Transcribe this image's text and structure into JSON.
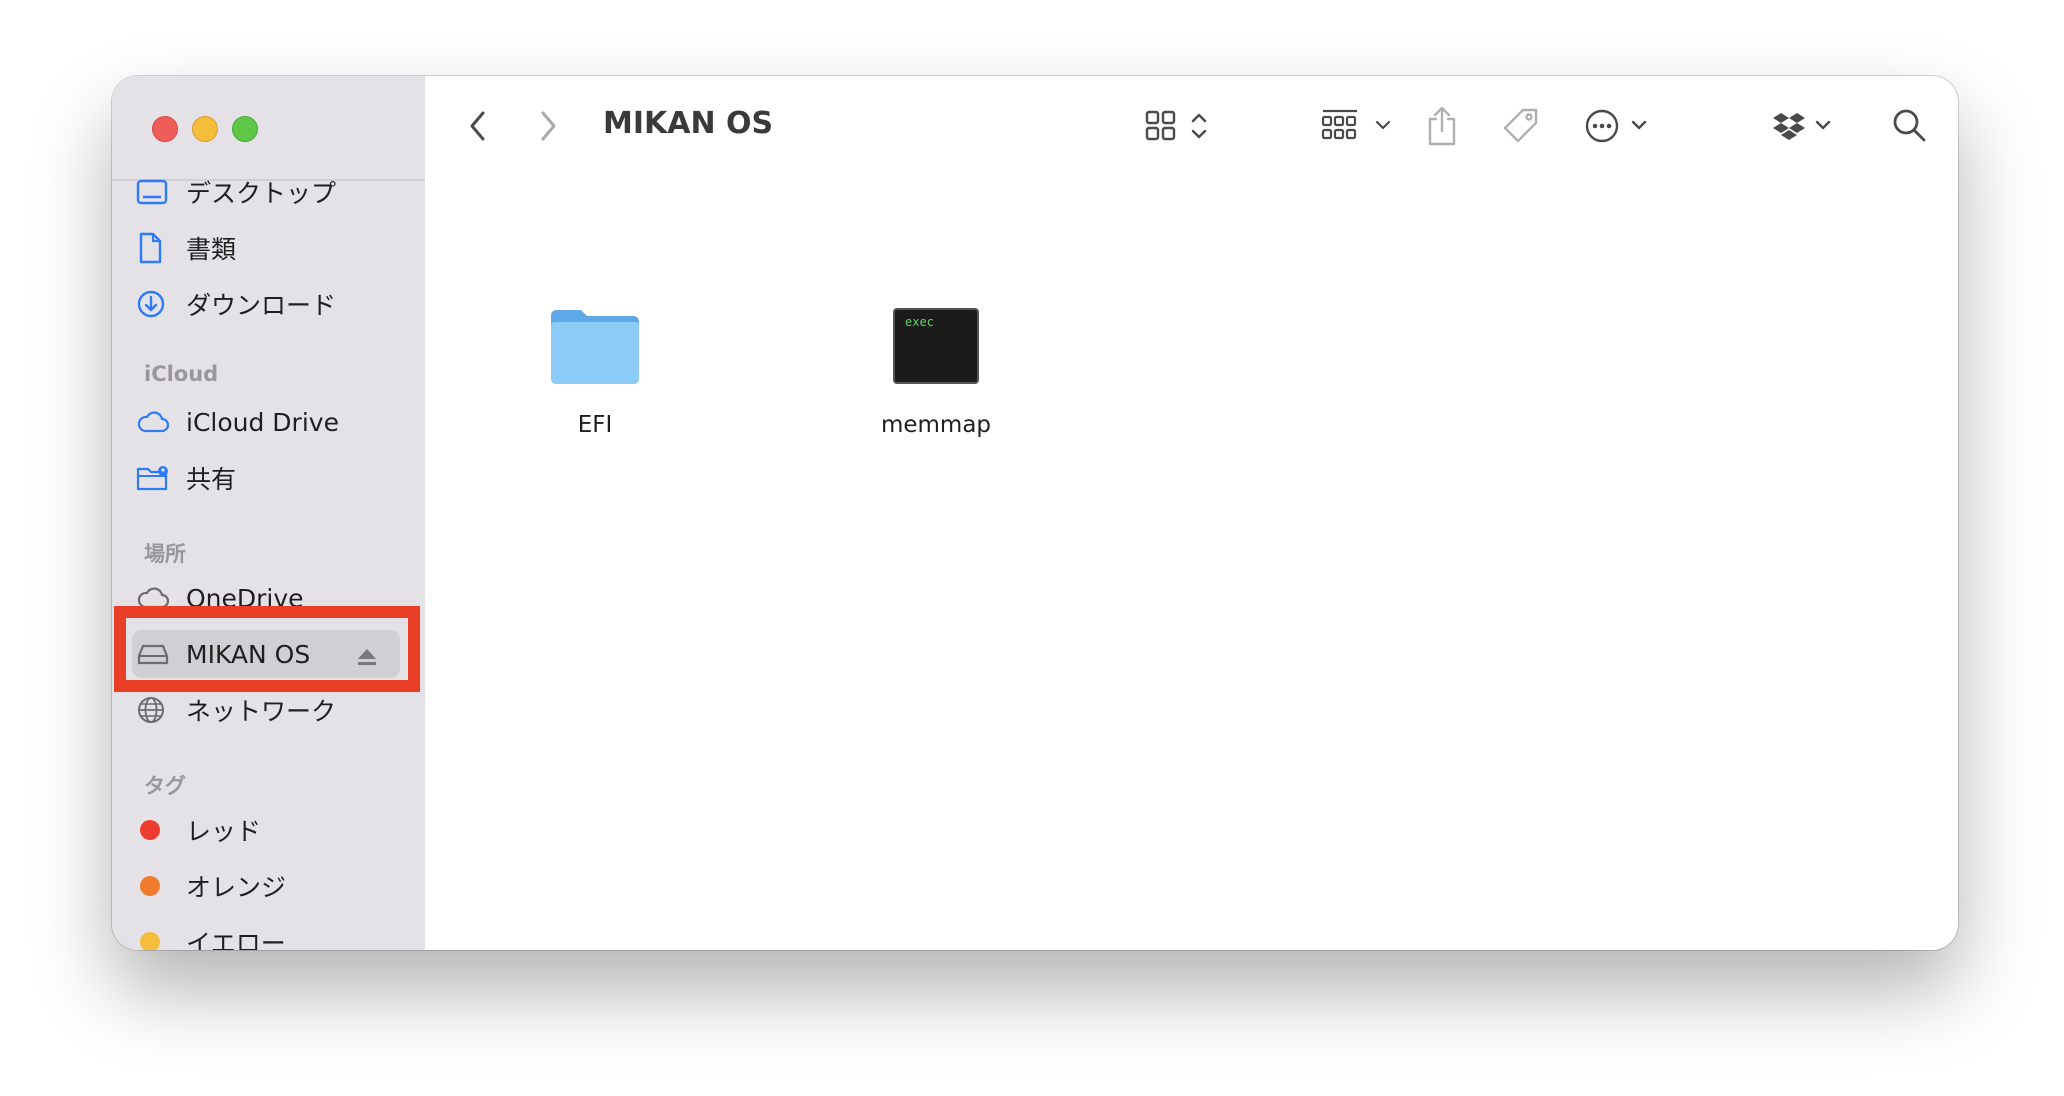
{
  "window": {
    "title": "MIKAN OS"
  },
  "sidebar": {
    "favorites": [
      {
        "label": "デスクトップ",
        "icon": "desktop-icon"
      },
      {
        "label": "書類",
        "icon": "document-icon"
      },
      {
        "label": "ダウンロード",
        "icon": "download-icon"
      }
    ],
    "icloud_header": "iCloud",
    "icloud": [
      {
        "label": "iCloud Drive",
        "icon": "cloud-icon"
      },
      {
        "label": "共有",
        "icon": "shared-folder-icon"
      }
    ],
    "locations_header": "場所",
    "locations": [
      {
        "label": "OneDrive",
        "icon": "cloud-icon"
      },
      {
        "label": "MIKAN OS",
        "icon": "drive-icon",
        "selected": true
      },
      {
        "label": "ネットワーク",
        "icon": "network-icon"
      }
    ],
    "tags_header": "タグ",
    "tags": [
      {
        "label": "レッド",
        "color": "#ee3b30"
      },
      {
        "label": "オレンジ",
        "color": "#f07b2c"
      },
      {
        "label": "イエロー",
        "color": "#f5bd3b"
      }
    ]
  },
  "content": {
    "items": [
      {
        "name": "EFI",
        "kind": "folder-icon"
      },
      {
        "name": "memmap",
        "kind": "exec-file-icon",
        "badge": "exec"
      }
    ]
  },
  "colors": {
    "accent": "#2f7bf5",
    "highlight": "#ea3f27",
    "folder": "#7cc0f5"
  }
}
